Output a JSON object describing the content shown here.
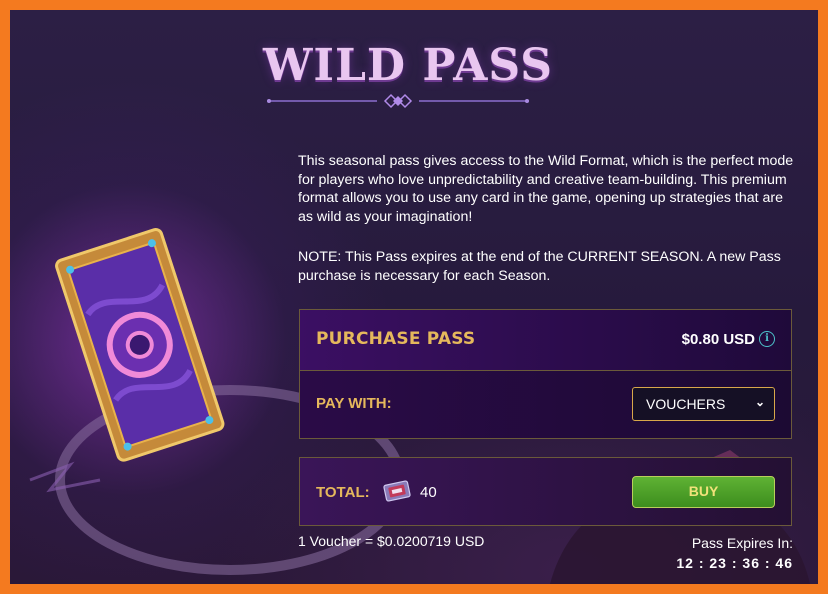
{
  "title": "WILD PASS",
  "description": "This seasonal pass gives access to the Wild Format, which is the perfect mode for players who love unpredictability and creative team-building. This premium format allows you to use any card in the game, opening up strategies that are as wild as your imagination!",
  "note": "NOTE: This Pass expires at the end of the CURRENT SEASON. A new Pass purchase is necessary for each Season.",
  "purchase": {
    "label": "PURCHASE PASS",
    "price": "$0.80 USD",
    "info_icon": "info-icon",
    "pay_with_label": "PAY WITH:",
    "pay_method": "VOUCHERS"
  },
  "total": {
    "label": "TOTAL:",
    "amount": "40",
    "buy_label": "BUY"
  },
  "rate": "1 Voucher = $0.0200719 USD",
  "expires": {
    "label": "Pass Expires In:",
    "timer": "12 : 23 : 36 : 46"
  },
  "colors": {
    "accent_gold": "#e5b85c",
    "buy_green": "#4fa02a",
    "border_orange": "#f47a1f",
    "title_pink": "#e9c6f0"
  }
}
